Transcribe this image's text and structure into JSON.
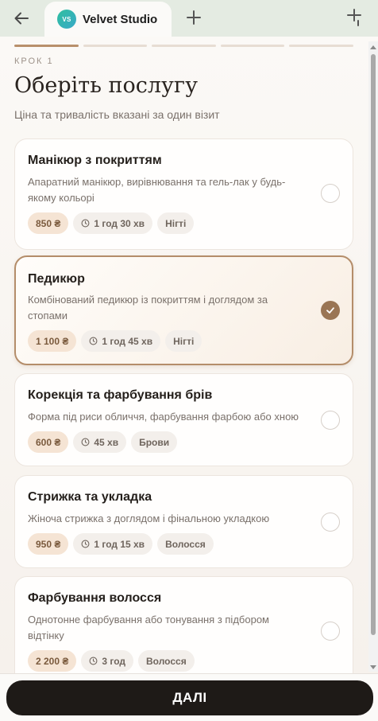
{
  "browser": {
    "tab_title": "Velvet Studio",
    "tab_avatar": "VS",
    "icons": {
      "back": "arrow-left-icon",
      "new_tab": "plus-icon",
      "menu": "menu-icon"
    }
  },
  "header": {
    "step_label": "КРОК 1",
    "title": "Оберіть послугу",
    "subtitle": "Ціна та тривалість вказані за один візит",
    "progress": {
      "total_steps": 5,
      "current_step": 1
    }
  },
  "services": [
    {
      "title": "Манікюр з покриттям",
      "description": "Апаратний манікюр, вирівнювання та гель-лак у будь-якому кольорі",
      "price": "850 ₴",
      "duration": "1 год 30 хв",
      "category": "Нігті",
      "selected": false
    },
    {
      "title": "Педикюр",
      "description": "Комбінований педикюр із покриттям і доглядом за стопами",
      "price": "1 100 ₴",
      "duration": "1 год 45 хв",
      "category": "Нігті",
      "selected": true
    },
    {
      "title": "Корекція та фарбування брів",
      "description": "Форма під риси обличчя, фарбування фарбою або хною",
      "price": "600 ₴",
      "duration": "45 хв",
      "category": "Брови",
      "selected": false
    },
    {
      "title": "Стрижка та укладка",
      "description": "Жіноча стрижка з доглядом і фінальною укладкою",
      "price": "950 ₴",
      "duration": "1 год 15 хв",
      "category": "Волосся",
      "selected": false
    },
    {
      "title": "Фарбування волосся",
      "description": "Однотонне фарбування або тонування з підбором відтінку",
      "price": "2 200 ₴",
      "duration": "3 год",
      "category": "Волосся",
      "selected": false
    }
  ],
  "footer": {
    "next_label": "ДАЛІ"
  },
  "colors": {
    "accent": "#b8906b",
    "selected_border": "#b48d6a",
    "check_fill": "#9a7554",
    "button_bg": "#1e1a17",
    "price_chip_bg": "#f5e4d4"
  }
}
